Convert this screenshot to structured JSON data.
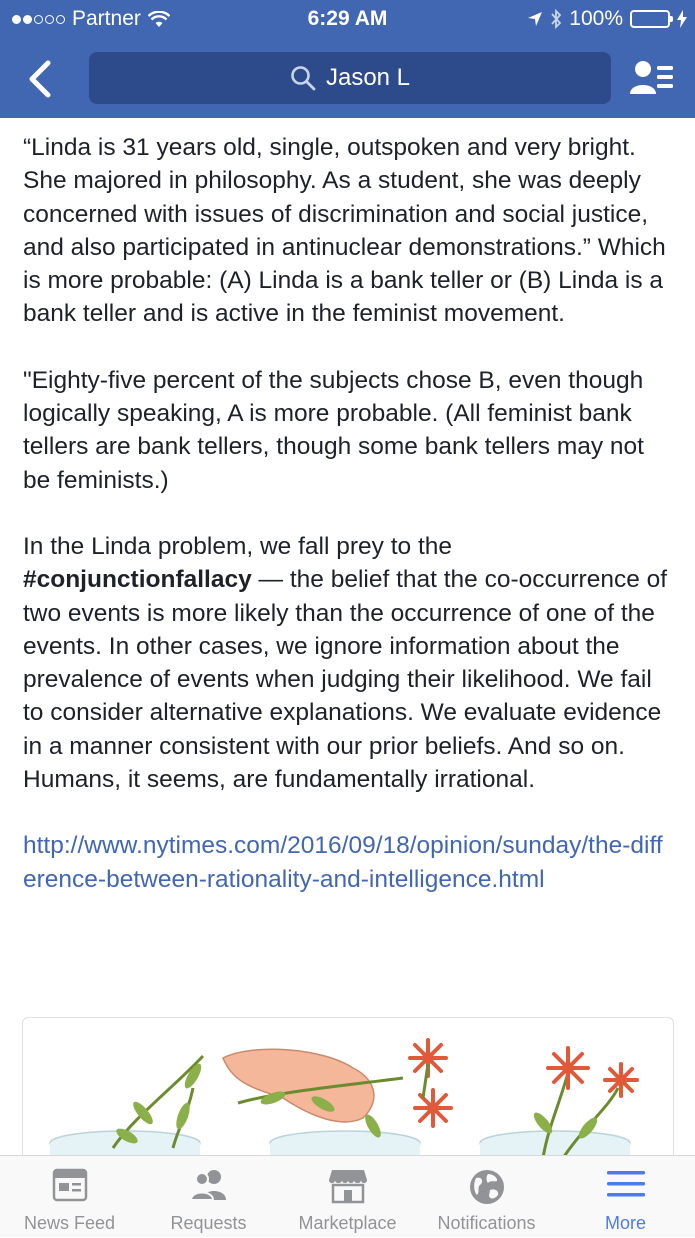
{
  "status_bar": {
    "carrier": "Partner",
    "time": "6:29 AM",
    "battery": "100%"
  },
  "header": {
    "search_text": "Jason L"
  },
  "post": {
    "paragraph1": "“Linda is 31 years old, single, outspoken and very bright. She majored in philosophy. As a student, she was deeply concerned with issues of discrimination and social justice, and also participated in antinuclear demonstrations.” Which is more probable: (A) Linda is a bank teller or (B) Linda is a bank teller and is active in the feminist movement.",
    "paragraph2": "\"Eighty-five percent of the subjects chose B, even though logically speaking, A is more probable. (All feminist bank tellers are bank tellers, though some bank tellers may not be feminists.)",
    "paragraph3_before": "In the Linda problem, we fall prey to the ",
    "paragraph3_hashtag": "#conjunctionfallacy",
    "paragraph3_after": " — the belief that the co-occurrence of two events is more likely than the occurrence of one of the events. In other cases, we ignore information about the prevalence of events when judging their likelihood. We fail to consider alternative explanations. We evaluate evidence in a manner consistent with our prior beliefs. And so on. Humans, it seems, are fundamentally irrational.",
    "link": "http://www.nytimes.com/2016/09/18/opinion/sunday/the-difference-between-rationality-and-intelligence.html"
  },
  "tabbar": {
    "tabs": [
      {
        "label": "News Feed",
        "icon": "news-feed-icon"
      },
      {
        "label": "Requests",
        "icon": "requests-icon"
      },
      {
        "label": "Marketplace",
        "icon": "marketplace-icon"
      },
      {
        "label": "Notifications",
        "icon": "globe-icon"
      },
      {
        "label": "More",
        "icon": "menu-icon",
        "active": true
      }
    ]
  },
  "colors": {
    "header_bg": "#4267b2",
    "search_bg": "#2d4a8a",
    "link": "#4267b2",
    "active_tab": "#4c7ce8",
    "inactive_tab": "#929396",
    "battery": "#5ee052"
  }
}
